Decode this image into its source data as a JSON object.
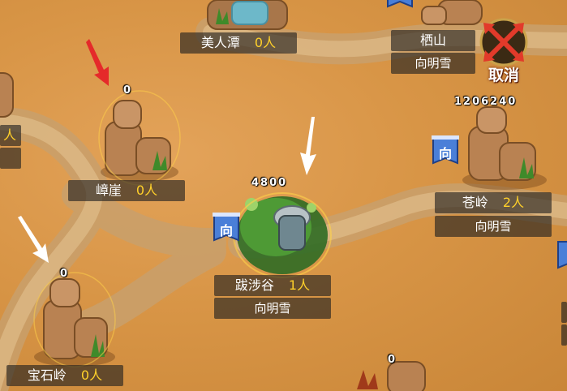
{
  "cancel_button": {
    "label": "取消",
    "icon": "crossed-arrows-icon",
    "color": "#e23a2a"
  },
  "nodes": {
    "meirentan": {
      "name": "美人潭",
      "count": "0人"
    },
    "qishan": {
      "name": "栖山",
      "owner": "向明雪"
    },
    "zhangya": {
      "name": "嶂崖",
      "count": "0人",
      "troops": "0"
    },
    "cangling": {
      "name": "苍岭",
      "count": "2人",
      "owner": "向明雪",
      "troops": "1206240",
      "flag": "向"
    },
    "bashegu": {
      "name": "跋涉谷",
      "count": "1人",
      "owner": "向明雪",
      "troops": "4800",
      "flag": "向"
    },
    "baoshiling": {
      "name": "宝石岭",
      "count": "0人",
      "troops": "0"
    },
    "left_edge": {
      "count": "人"
    },
    "bottom_node": {
      "troops": "0"
    }
  },
  "markers": {
    "red_arrow_color": "#e52a2a",
    "white_arrow_color": "#ffffff"
  },
  "colors": {
    "count_text": "#ffd02a",
    "flag_blue": "#4a7fd8"
  }
}
